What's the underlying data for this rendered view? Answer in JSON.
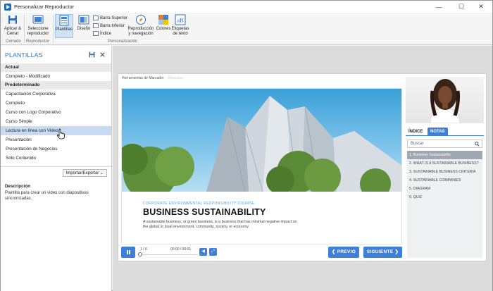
{
  "window": {
    "title": "Personalizar Reproductor"
  },
  "ribbon": {
    "apply_close": "Aplicar & Cerrar",
    "group_cerrado": "Cerrado",
    "select_player": "Seleccione reproductor",
    "group_reproductor": "Reproductor",
    "plantillas": "Plantillas",
    "diseno": "Diseño",
    "barra_superior": "Barra Superior",
    "barra_inferior": "Barra Inferior",
    "indice": "Índice",
    "reproduccion": "Reproducción y navegación",
    "colores": "Colores",
    "etiquetas": "Etiquetas de texto",
    "group_personalizacion": "Personalización"
  },
  "left": {
    "title": "PLANTILLAS",
    "section_actual": "Actual",
    "current_item": "Completo - Modificado",
    "section_predeterminado": "Predeterminado",
    "items": [
      "Capacitación Corporativa",
      "Completo",
      "Curso con Logo Corporativo",
      "Curso Simple",
      "Lectura en línea con Video",
      "Presentación",
      "Presentación de Negocios",
      "Solo Contenido"
    ],
    "import_export": "Importar/Exportar",
    "desc_title": "Descripción",
    "desc_text": "Plantilla para crear un video con diapositivas sincronizadas."
  },
  "player": {
    "tabs": [
      "Herramientas de Marcador",
      "Recursos"
    ],
    "slide_subtitle": "CORPORATE ENVIRONMENTAL RESPONSIBILITY COURSE",
    "slide_title": "BUSINESS SUSTAINABILITY",
    "slide_text": "A sustainable business, or green business, is a business that has minimal negative impact on the global or local environment, community, society, or economy.",
    "slide_count": "1 / 6",
    "time": "00:00 / 00:01",
    "prev": "❮ PREVIO",
    "next": "SIGUIENTE ❯",
    "tab_indice": "ÍNDICE",
    "tab_notas": "NOTAS",
    "search_placeholder": "Buscar",
    "toc": [
      "1. Business Sustainability",
      "2. WHAT IS A SUSTAINABLE BUSINESS?",
      "3. SUSTAINABLE BUSINESS CRITERIA",
      "4. SUSTAINABLE COMPANIES",
      "5. DIAGRAM",
      "6. QUIZ"
    ]
  }
}
